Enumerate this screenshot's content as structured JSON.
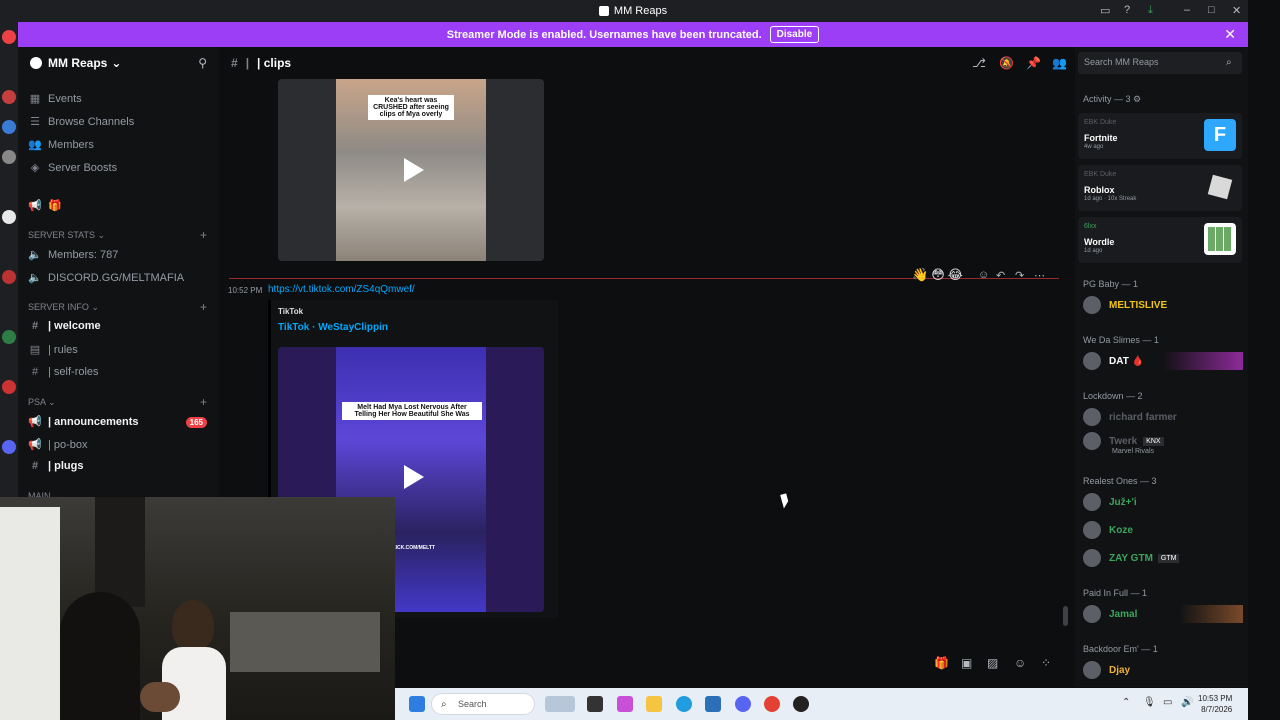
{
  "window": {
    "title": "MM Reaps"
  },
  "banner": {
    "text": "Streamer Mode is enabled. Usernames have been truncated.",
    "button": "Disable"
  },
  "guild": {
    "name": "MM Reaps"
  },
  "sidebar": {
    "top_items": [
      {
        "label": "Events",
        "icon": "calendar-icon"
      },
      {
        "label": "Browse Channels",
        "icon": "browse-icon"
      },
      {
        "label": "Members",
        "icon": "members-icon"
      },
      {
        "label": "Server Boosts",
        "icon": "boost-icon"
      }
    ],
    "categories": {
      "server_stats": "SERVER STATS",
      "server_info": "SERVER INFO",
      "psa": "PSA",
      "main": "MAIN"
    },
    "stats": [
      "Members: 787",
      "DISCORD.GG/MELTMAFIA"
    ],
    "info_channels": [
      "| welcome",
      "| rules",
      "| self-roles"
    ],
    "psa_channels": [
      {
        "label": "| announcements",
        "badge": "165"
      },
      {
        "label": "| po-box"
      },
      {
        "label": "| plugs"
      }
    ]
  },
  "channel": {
    "name": "| clips"
  },
  "chat": {
    "video1_caption": "Kea's heart was CRUSHED after seeing clips of Mya overly",
    "message_time": "10:52 PM",
    "message_link": "https://vt.tiktok.com/ZS4qQmwef/",
    "embed_provider": "TikTok",
    "embed_title": "TikTok · WeStayClippin",
    "video2_caption": "Melt Had Mya Lost Nervous After Telling Her How Beautiful She Was",
    "video2_watermark": "KICK.COM/MELTT",
    "reactions": [
      "👋",
      "😳",
      "😂"
    ]
  },
  "members": {
    "search_placeholder": "Search MM Reaps",
    "activity_label": "Activity — 3",
    "activities": [
      {
        "user": "EBK Duke",
        "game": "Fortnite",
        "meta": "4w ago",
        "color": "#2ea8ff"
      },
      {
        "user": "EBK Duke",
        "game": "Roblox",
        "meta": "1d ago · 10x Streak",
        "color": "#d9d9d9"
      },
      {
        "user": "6lxx",
        "game": "Wordle",
        "meta": "1d ago",
        "color": "#6aaa64"
      }
    ],
    "groups": [
      {
        "label": "PG Baby — 1",
        "members": [
          {
            "name": "MELTISLIVE",
            "color": "#f1c40f"
          }
        ]
      },
      {
        "label": "We Da Slimes — 1",
        "members": [
          {
            "name": "DAT 🩸",
            "color": "#ffffff"
          }
        ]
      },
      {
        "label": "Lockdown — 2",
        "members": [
          {
            "name": "richard farmer",
            "color": "#5a5e66"
          },
          {
            "name": "Twerk",
            "color": "#5a5e66",
            "tag": "KNX",
            "sub": "Marvel Rivals"
          }
        ]
      },
      {
        "label": "Realest Ones — 3",
        "members": [
          {
            "name": "Juž+'i",
            "color": "#3ba55c"
          },
          {
            "name": "Koze",
            "color": "#3ba55c"
          },
          {
            "name": "ZAY GTM",
            "color": "#3ba55c",
            "tag": "GTM"
          }
        ]
      },
      {
        "label": "Paid In Full — 1",
        "members": [
          {
            "name": "Jamal",
            "color": "#3ba55c"
          }
        ]
      },
      {
        "label": "Backdoor Em' — 1",
        "members": [
          {
            "name": "Djay",
            "color": "#f0b232"
          }
        ]
      }
    ]
  },
  "taskbar": {
    "search": "Search",
    "time": "10:53 PM",
    "date": "8/7/2026"
  },
  "colors": {
    "accent": "#9d3ef7",
    "link": "#00a8fc",
    "badge": "#ed4245"
  }
}
